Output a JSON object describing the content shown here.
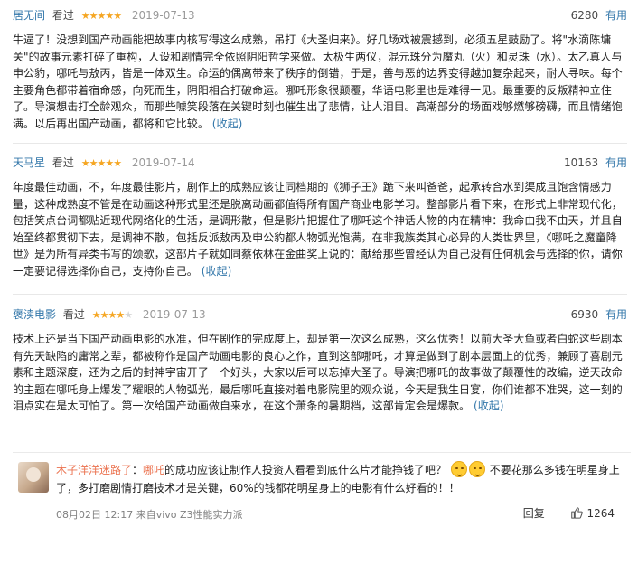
{
  "reviews": [
    {
      "user": "居无间",
      "watched": "看过",
      "rating": 5,
      "date": "2019-07-13",
      "votes": "6280",
      "useful": "有用",
      "body": "牛逼了！没想到国产动画能把故事内核写得这么成熟，吊打《大圣归来》。好几场戏被震撼到，必须五星鼓励了。将\"水滴陈墉关\"的故事元素打碎了重构，人设和剧情完全依照阴阳哲学来做。太极生两仪，混元珠分为魔丸（火）和灵珠（水）。太乙真人与申公豹，哪吒与敖丙，皆是一体双生。命运的偶离带来了秩序的倒错，于是，善与恶的边界变得越加复杂起来，耐人寻味。每个主要角色都带着宿命感，向死而生，阴阳相合打破命运。哪吒形象很颠覆，华语电影里也是难得一见。最重要的反叛精神立住了。导演想击打全龄观众，而那些噱笑段落在关键时刻也催生出了悲情，让人泪目。高潮部分的场面戏够燃够磅礴，而且情绪饱满。以后再出国产动画，都将和它比较。",
      "expand": "(收起)"
    },
    {
      "user": "天马星",
      "watched": "看过",
      "rating": 5,
      "date": "2019-07-14",
      "votes": "10163",
      "useful": "有用",
      "body": "年度最佳动画，不，年度最佳影片，剧作上的成熟应该让同档期的《狮子王》跪下来叫爸爸，起承转合水到渠成且饱含情感力量，这种成熟度不管是在动画这种形式里还是脱离动画都值得所有国产商业电影学习。整部影片看下来，在形式上非常现代化，包括笑点台词都贴近现代网络化的生活，是调形散，但是影片把握住了哪吒这个神话人物的内在精神：我命由我不由天，并且自始至终都贯彻下去，是调神不散，包括反派敖丙及申公豹都人物弧光饱满，在非我族类其心必异的人类世界里，《哪吒之魔童降世》是为所有异类书写的颂歌，这部片子就如同蔡依林在金曲奖上说的：献给那些曾经认为自己没有任何机会与选择的你，请你一定要记得选择你自己，支持你自己。",
      "expand": "(收起)"
    },
    {
      "user": "褒渎电影",
      "watched": "看过",
      "rating": 4,
      "date": "2019-07-13",
      "votes": "6930",
      "useful": "有用",
      "body": "技术上还是当下国产动画电影的水准，但在剧作的完成度上，却是第一次这么成熟，这么优秀！以前大圣大鱼或者白蛇这些剧本有先天缺陷的庸常之辈，都被称作是国产动画电影的良心之作，直到这部哪吒，才算是做到了剧本层面上的优秀，兼顾了喜剧元素和主题深度，还为之后的封神宇宙开了一个好头，大家以后可以忘掉大圣了。导演把哪吒的故事做了颠覆性的改编，逆天改命的主题在哪吒身上爆发了耀眼的人物弧光，最后哪吒直接对着电影院里的观众说，今天是我生日宴，你们谁都不准哭，这一刻的泪点实在是太可怕了。第一次给国产动画做自来水，在这个萧条的暑期档，这部肯定会是爆款。",
      "expand": "(收起)"
    }
  ],
  "comment": {
    "user": "木子洋洋迷路了",
    "colon": "：",
    "topic": "哪吒",
    "text_part1": "的成功应该让制作人投资人看看到底什么片才能挣钱了吧？",
    "text_part2": "不要花那么多钱在明星身上了，多打磨剧情打磨技术才是关键，60%的钱都花明星身上的电影有什么好看的！！",
    "emoji_names": [
      "smile-emoji",
      "smile-emoji"
    ],
    "time": "08月02日 12:17",
    "source": "来自vivo Z3性能实力派",
    "reply": "回复",
    "likes": "1264"
  },
  "colors": {
    "link": "#3377aa",
    "star": "#f5a623",
    "comment_user": "#eb7350"
  }
}
